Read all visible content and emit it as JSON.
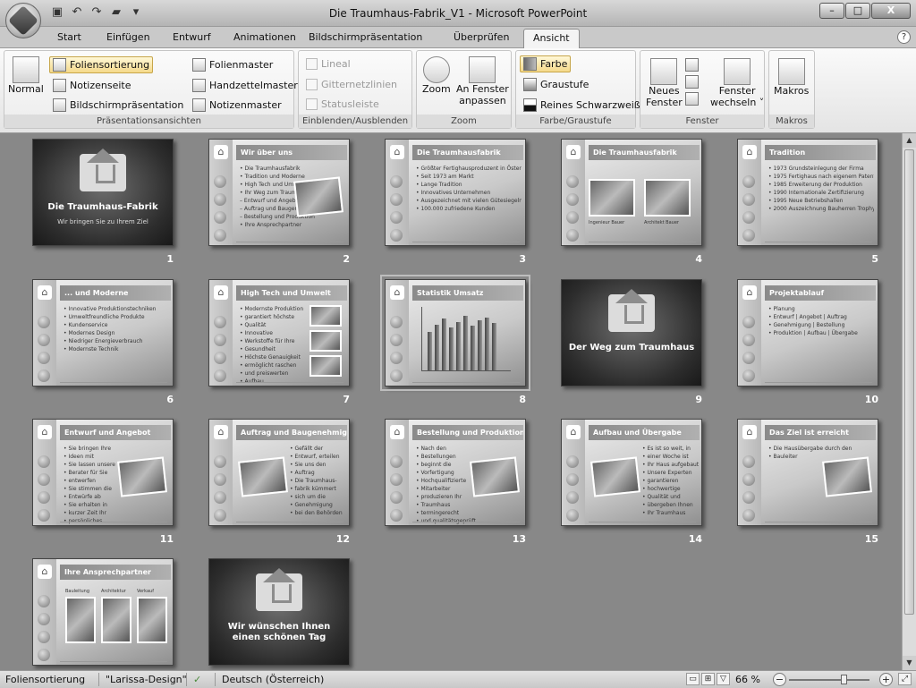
{
  "window": {
    "title": "Die Traumhaus-Fabrik_V1 - Microsoft PowerPoint",
    "controls": {
      "minimize": "–",
      "maximize": "□",
      "close": "X"
    }
  },
  "quick_access": [
    "save-icon",
    "undo-icon",
    "redo-icon",
    "open-icon",
    "customize-icon"
  ],
  "tabs": [
    {
      "label": "Start"
    },
    {
      "label": "Einfügen"
    },
    {
      "label": "Entwurf"
    },
    {
      "label": "Animationen"
    },
    {
      "label": "Bildschirmpräsentation"
    },
    {
      "label": "Überprüfen"
    },
    {
      "label": "Ansicht",
      "active": true
    }
  ],
  "ribbon": {
    "presentation_views": {
      "label": "Präsentationsansichten",
      "normal": "Normal",
      "slide_sorter": "Foliensortierung",
      "notes_page": "Notizenseite",
      "slide_show": "Bildschirmpräsentation",
      "slide_master": "Folienmaster",
      "handout_master": "Handzettelmaster",
      "notes_master": "Notizenmaster"
    },
    "show_hide": {
      "label": "Einblenden/Ausblenden",
      "ruler": "Lineal",
      "gridlines": "Gitternetzlinien",
      "statusbar": "Statusleiste"
    },
    "zoom": {
      "label": "Zoom",
      "zoom": "Zoom",
      "fit_line1": "An Fenster",
      "fit_line2": "anpassen"
    },
    "color": {
      "label": "Farbe/Graustufe",
      "color": "Farbe",
      "grayscale": "Graustufe",
      "pure_bw": "Reines Schwarzweiß"
    },
    "window": {
      "label": "Fenster",
      "new_line1": "Neues",
      "new_line2": "Fenster",
      "switch_line1": "Fenster",
      "switch_line2": "wechseln ˅"
    },
    "macros": {
      "label": "Makros",
      "macros": "Makros"
    }
  },
  "slides": [
    {
      "num": "1",
      "kind": "dark",
      "title": "Die Traumhaus-Fabrik",
      "subtitle": "Wir bringen Sie zu Ihrem Ziel"
    },
    {
      "num": "2",
      "kind": "content",
      "title": "Wir über uns",
      "bullets": [
        "Die Traumhausfabrik",
        "Tradition und Moderne",
        "High Tech und Umwelt",
        "Ihr Weg zum Traumhaus",
        "– Entwurf und Angebot",
        "– Auftrag und Baugenehmigung",
        "– Bestellung und Produktion",
        "Ihre Ansprechpartner"
      ],
      "pics": 1
    },
    {
      "num": "3",
      "kind": "content",
      "title": "Die Traumhausfabrik",
      "bullets": [
        "Größter Fertighausproduzent in Österreich",
        "Seit 1973 am Markt",
        "Lange Tradition",
        "Innovatives Unternehmen",
        "Ausgezeichnet mit vielen Gütesiegeln",
        "100.000 zufriedene Kunden"
      ]
    },
    {
      "num": "4",
      "kind": "content",
      "title": "Die Traumhausfabrik",
      "bullets": [],
      "pics": 2,
      "captions": [
        "Ingenieur Bauer",
        "Architekt Bauer"
      ]
    },
    {
      "num": "5",
      "kind": "content",
      "title": "Tradition",
      "bullets": [
        "1973 Grundsteinlegung der Firma",
        "1975 Fertighaus nach eigenem Patent",
        "1985 Erweiterung der Produktion",
        "1990 Internationale Zertifizierung",
        "1995 Neue Betriebshallen",
        "2000 Auszeichnung Bauherren Trophy"
      ]
    },
    {
      "num": "6",
      "kind": "content",
      "title": "... und Moderne",
      "bullets": [
        "Innovative Produktionstechniken",
        "Umweltfreundliche Produkte",
        "Kundenservice",
        "Modernes Design",
        "Niedriger Energieverbrauch",
        "Modernste Technik"
      ]
    },
    {
      "num": "7",
      "kind": "content",
      "title": "High Tech und Umwelt",
      "bullets": [
        "Modernste Produktion",
        "garantiert höchste",
        "Qualität",
        "Innovative",
        "Werkstoffe für Ihre",
        "Gesundheit",
        "Höchste Genauigkeit",
        "ermöglicht raschen",
        "und preiswerten",
        "Aufbau"
      ],
      "pics": 3
    },
    {
      "num": "8",
      "kind": "chart",
      "title": "Statistik Umsatz",
      "bars": [
        52,
        62,
        70,
        58,
        66,
        74,
        60,
        68,
        72,
        64
      ],
      "selected": true
    },
    {
      "num": "9",
      "kind": "dark",
      "title": "Der Weg zum Traumhaus",
      "subtitle": ""
    },
    {
      "num": "10",
      "kind": "content",
      "title": "Projektablauf",
      "bullets": [
        "Planung",
        "Entwurf | Angebot | Auftrag",
        "Genehmigung | Bestellung",
        "Produktion | Aufbau | Übergabe"
      ]
    },
    {
      "num": "11",
      "kind": "content",
      "title": "Entwurf und Angebot",
      "bullets": [
        "Sie bringen Ihre",
        "Ideen mit",
        "Sie lassen unsere",
        "Berater für Sie",
        "entwerfen",
        "Sie stimmen die",
        "Entwürfe ab",
        "Sie erhalten in",
        "kurzer Zeit Ihr",
        "persönliches",
        "Angebot"
      ],
      "pics": 1
    },
    {
      "num": "12",
      "kind": "content",
      "title": "Auftrag und Baugenehmigung",
      "bullets": [
        "Gefällt der",
        "Entwurf, erteilen",
        "Sie uns den",
        "Auftrag",
        "Die Traumhaus-",
        "fabrik kümmert",
        "sich um die",
        "Genehmigung",
        "bei den Behörden"
      ],
      "pics": 1,
      "pic_left": true
    },
    {
      "num": "13",
      "kind": "content",
      "title": "Bestellung und Produktion",
      "bullets": [
        "Nach den",
        "Bestellungen",
        "beginnt die",
        "Vorfertigung",
        "Hochqualifizierte",
        "Mitarbeiter",
        "produzieren Ihr",
        "Traumhaus",
        "termingerecht",
        "und qualitätsgeprüft"
      ],
      "pics": 1
    },
    {
      "num": "14",
      "kind": "content",
      "title": "Aufbau und Übergabe",
      "bullets": [
        "Es ist so weit, in",
        "einer Woche ist",
        "Ihr Haus aufgebaut",
        "Unsere Experten",
        "garantieren",
        "hochwertige",
        "Qualität und",
        "übergeben Ihnen",
        "Ihr Traumhaus"
      ],
      "pics": 1,
      "pic_left": true
    },
    {
      "num": "15",
      "kind": "content",
      "title": "Das Ziel ist erreicht",
      "bullets": [
        "Die Hausübergabe durch den",
        "Bauleiter"
      ],
      "pics": 1
    },
    {
      "num": "16",
      "kind": "content",
      "title": "Ihre Ansprechpartner",
      "bullets": [],
      "pics": 3,
      "captions": [
        "Bauleitung",
        "Architektur",
        "Verkauf"
      ]
    },
    {
      "num": "17",
      "kind": "dark",
      "title": "Wir wünschen Ihnen einen schönen Tag",
      "subtitle": ""
    }
  ],
  "statusbar": {
    "view": "Foliensortierung",
    "theme": "\"Larissa-Design\"",
    "language": "Deutsch (Österreich)",
    "zoom": "66 %",
    "zoom_level": 0.66
  },
  "colors": {
    "workspace": "#888888",
    "ribbon_active": "#f4d58a"
  }
}
